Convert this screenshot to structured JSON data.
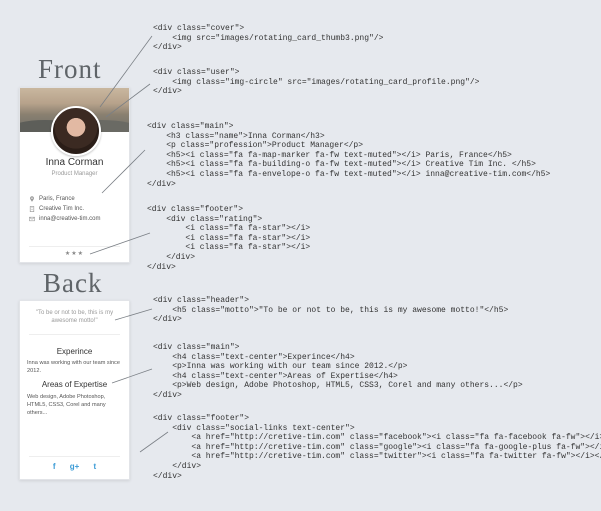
{
  "labels": {
    "front": "Front",
    "back": "Back"
  },
  "front_card": {
    "name": "Inna Corman",
    "profession": "Product Manager",
    "location": "Paris, France",
    "company": "Creative Tim Inc.",
    "email": "inna@creative-tim.com",
    "stars": "★★★"
  },
  "back_card": {
    "motto": "\"To be or not to be, this is my awesome motto!\"",
    "h_experience": "Experince",
    "p_experience": "Inna was working with our team since 2012.",
    "h_expertise": "Areas of Expertise",
    "p_expertise": "Web design, Adobe Photoshop, HTML5, CSS3, Corel and many others...",
    "social_icons": [
      "facebook-icon",
      "google-plus-icon",
      "twitter-icon"
    ],
    "social_glyphs": [
      "f",
      "g+",
      "t"
    ]
  },
  "code": {
    "cover": "<div class=\"cover\">\n    <img src=\"images/rotating_card_thumb3.png\"/>\n</div>",
    "user": "<div class=\"user\">\n    <img class=\"img-circle\" src=\"images/rotating_card_profile.png\"/>\n</div>",
    "main_front": "<div class=\"main\">\n    <h3 class=\"name\">Inna Corman</h3>\n    <p class=\"profession\">Product Manager</p>\n    <h5><i class=\"fa fa-map-marker fa-fw text-muted\"></i> Paris, France</h5>\n    <h5><i class=\"fa fa-building-o fa-fw text-muted\"></i> Creative Tim Inc. </h5>\n    <h5><i class=\"fa fa-envelope-o fa-fw text-muted\"></i> inna@creative-tim.com</h5>\n</div>",
    "footer_front": "<div class=\"footer\">\n    <div class=\"rating\">\n        <i class=\"fa fa-star\"></i>\n        <i class=\"fa fa-star\"></i>\n        <i class=\"fa fa-star\"></i>\n    </div>\n</div>",
    "header_back": "<div class=\"header\">\n    <h5 class=\"motto\">\"To be or not to be, this is my awesome motto!\"</h5>\n</div>",
    "main_back": "<div class=\"main\">\n    <h4 class=\"text-center\">Experince</h4>\n    <p>Inna was working with our team since 2012.</p>\n    <h4 class=\"text-center\">Areas of Expertise</h4>\n    <p>Web design, Adobe Photoshop, HTML5, CSS3, Corel and many others...</p>\n</div>",
    "footer_back": "<div class=\"footer\">\n    <div class=\"social-links text-center\">\n        <a href=\"http://cretive-tim.com\" class=\"facebook\"><i class=\"fa fa-facebook fa-fw\"></i></a>\n        <a href=\"http://cretive-tim.com\" class=\"google\"><i class=\"fa fa-google-plus fa-fw\"></i></a>\n        <a href=\"http://cretive-tim.com\" class=\"twitter\"><i class=\"fa fa-twitter fa-fw\"></i></a>\n    </div>\n</div>"
  }
}
